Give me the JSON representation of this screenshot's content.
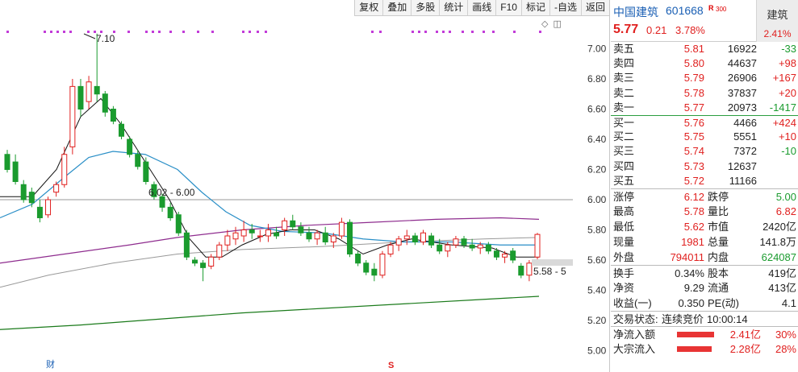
{
  "toolbar": [
    "复权",
    "叠加",
    "多股",
    "统计",
    "画线",
    "F10",
    "标记",
    "-自选",
    "返回"
  ],
  "chart": {
    "price_axis": [
      "7.00",
      "6.80",
      "6.60",
      "6.40",
      "6.20",
      "6.00",
      "5.80",
      "5.60",
      "5.40",
      "5.20",
      "5.00"
    ],
    "high_label": "7.10",
    "box_label": "6.02 - 6.00",
    "current_label": "5.58 - 5",
    "bottom_marker_left": "财",
    "bottom_marker_right": "S",
    "colors": {
      "up": "#e0201f",
      "down": "#1a9b2e",
      "ma5": "#111111",
      "ma10": "#2a8fc7",
      "ma20": "#8e2c8e",
      "ma60": "#999999",
      "ma120": "#1a7a1a",
      "marker": "#c23bd8"
    }
  },
  "chart_data": {
    "type": "candlestick",
    "ylim": [
      4.95,
      7.15
    ],
    "candles": [
      [
        6.3,
        6.33,
        6.18,
        6.2
      ],
      [
        6.25,
        6.3,
        6.1,
        6.12
      ],
      [
        6.1,
        6.13,
        5.98,
        6.0
      ],
      [
        6.05,
        6.08,
        5.95,
        5.98
      ],
      [
        5.95,
        6.0,
        5.85,
        5.88
      ],
      [
        5.9,
        6.02,
        5.88,
        6.0
      ],
      [
        6.05,
        6.12,
        6.02,
        6.1
      ],
      [
        6.1,
        6.35,
        6.08,
        6.3
      ],
      [
        6.35,
        6.8,
        6.3,
        6.75
      ],
      [
        6.75,
        6.8,
        6.55,
        6.6
      ],
      [
        6.65,
        6.82,
        6.6,
        6.78
      ],
      [
        6.75,
        7.1,
        6.65,
        6.7
      ],
      [
        6.7,
        6.72,
        6.55,
        6.58
      ],
      [
        6.6,
        6.62,
        6.5,
        6.52
      ],
      [
        6.5,
        6.52,
        6.4,
        6.42
      ],
      [
        6.4,
        6.42,
        6.28,
        6.3
      ],
      [
        6.3,
        6.33,
        6.2,
        6.22
      ],
      [
        6.25,
        6.28,
        6.1,
        6.12
      ],
      [
        6.1,
        6.12,
        6.0,
        6.02
      ],
      [
        6.02,
        6.04,
        5.92,
        5.95
      ],
      [
        5.95,
        5.98,
        5.86,
        5.88
      ],
      [
        5.9,
        5.92,
        5.76,
        5.78
      ],
      [
        5.78,
        5.8,
        5.6,
        5.62
      ],
      [
        5.6,
        5.62,
        5.56,
        5.58
      ],
      [
        5.58,
        5.6,
        5.46,
        5.55
      ],
      [
        5.56,
        5.64,
        5.54,
        5.62
      ],
      [
        5.62,
        5.72,
        5.6,
        5.7
      ],
      [
        5.7,
        5.8,
        5.66,
        5.76
      ],
      [
        5.74,
        5.82,
        5.7,
        5.78
      ],
      [
        5.76,
        5.86,
        5.72,
        5.8
      ],
      [
        5.8,
        5.84,
        5.74,
        5.78
      ],
      [
        5.76,
        5.8,
        5.72,
        5.76
      ],
      [
        5.76,
        5.84,
        5.72,
        5.8
      ],
      [
        5.78,
        5.82,
        5.74,
        5.76
      ],
      [
        5.8,
        5.88,
        5.76,
        5.86
      ],
      [
        5.86,
        5.9,
        5.8,
        5.82
      ],
      [
        5.82,
        5.85,
        5.76,
        5.78
      ],
      [
        5.78,
        5.82,
        5.72,
        5.74
      ],
      [
        5.74,
        5.8,
        5.7,
        5.78
      ],
      [
        5.78,
        5.82,
        5.7,
        5.72
      ],
      [
        5.72,
        5.78,
        5.68,
        5.76
      ],
      [
        5.76,
        5.88,
        5.74,
        5.85
      ],
      [
        5.85,
        5.87,
        5.62,
        5.64
      ],
      [
        5.64,
        5.66,
        5.56,
        5.58
      ],
      [
        5.58,
        5.6,
        5.5,
        5.52
      ],
      [
        5.54,
        5.58,
        5.46,
        5.5
      ],
      [
        5.5,
        5.66,
        5.48,
        5.64
      ],
      [
        5.64,
        5.72,
        5.62,
        5.7
      ],
      [
        5.7,
        5.76,
        5.66,
        5.74
      ],
      [
        5.74,
        5.8,
        5.7,
        5.76
      ],
      [
        5.76,
        5.78,
        5.7,
        5.72
      ],
      [
        5.72,
        5.8,
        5.7,
        5.78
      ],
      [
        5.76,
        5.78,
        5.68,
        5.7
      ],
      [
        5.7,
        5.74,
        5.64,
        5.66
      ],
      [
        5.66,
        5.72,
        5.62,
        5.7
      ],
      [
        5.7,
        5.76,
        5.68,
        5.74
      ],
      [
        5.74,
        5.76,
        5.68,
        5.7
      ],
      [
        5.7,
        5.74,
        5.66,
        5.68
      ],
      [
        5.68,
        5.72,
        5.64,
        5.7
      ],
      [
        5.7,
        5.72,
        5.64,
        5.66
      ],
      [
        5.66,
        5.68,
        5.6,
        5.62
      ],
      [
        5.62,
        5.66,
        5.58,
        5.64
      ],
      [
        5.66,
        5.68,
        5.58,
        5.6
      ],
      [
        5.56,
        5.58,
        5.48,
        5.5
      ],
      [
        5.5,
        5.6,
        5.46,
        5.58
      ],
      [
        5.62,
        5.78,
        5.6,
        5.77
      ]
    ]
  },
  "stock": {
    "name": "中国建筑",
    "code": "601668",
    "r_badge": "R",
    "r_num": "300",
    "price": "5.77",
    "change": "0.21",
    "change_pct": "3.78%",
    "sector": "建筑",
    "sector_pct": "2.41%"
  },
  "sell": [
    {
      "label": "卖五",
      "price": "5.81",
      "vol": "16922",
      "delta": "-33",
      "delta_color": "green"
    },
    {
      "label": "卖四",
      "price": "5.80",
      "vol": "44637",
      "delta": "+98",
      "delta_color": "red"
    },
    {
      "label": "卖三",
      "price": "5.79",
      "vol": "26906",
      "delta": "+167",
      "delta_color": "red"
    },
    {
      "label": "卖二",
      "price": "5.78",
      "vol": "37837",
      "delta": "+20",
      "delta_color": "red"
    },
    {
      "label": "卖一",
      "price": "5.77",
      "vol": "20973",
      "delta": "-1417",
      "delta_color": "green"
    }
  ],
  "buy": [
    {
      "label": "买一",
      "price": "5.76",
      "vol": "4466",
      "delta": "+424",
      "delta_color": "red"
    },
    {
      "label": "买二",
      "price": "5.75",
      "vol": "5551",
      "delta": "+10",
      "delta_color": "red"
    },
    {
      "label": "买三",
      "price": "5.74",
      "vol": "7372",
      "delta": "-10",
      "delta_color": "green"
    },
    {
      "label": "买四",
      "price": "5.73",
      "vol": "12637",
      "delta": "",
      "delta_color": "red"
    },
    {
      "label": "买五",
      "price": "5.72",
      "vol": "11166",
      "delta": "",
      "delta_color": "red"
    }
  ],
  "stats1": [
    {
      "l1": "涨停",
      "v1": "6.12",
      "c1": "red",
      "l2": "跌停",
      "v2": "5.00",
      "c2": "green"
    },
    {
      "l1": "最高",
      "v1": "5.78",
      "c1": "red",
      "l2": "量比",
      "v2": "6.82",
      "c2": "red"
    },
    {
      "l1": "最低",
      "v1": "5.62",
      "c1": "red",
      "l2": "市值",
      "v2": "2420亿",
      "c2": "dark"
    },
    {
      "l1": "现量",
      "v1": "1981",
      "c1": "red",
      "l2": "总量",
      "v2": "141.8万",
      "c2": "dark"
    },
    {
      "l1": "外盘",
      "v1": "794011",
      "c1": "red",
      "l2": "内盘",
      "v2": "624087",
      "c2": "green"
    }
  ],
  "stats2": [
    {
      "l1": "换手",
      "v1": "0.34%",
      "c1": "dark",
      "l2": "股本",
      "v2": "419亿",
      "c2": "dark"
    },
    {
      "l1": "净资",
      "v1": "9.29",
      "c1": "dark",
      "l2": "流通",
      "v2": "413亿",
      "c2": "dark"
    },
    {
      "l1": "收益(一)",
      "v1": "0.350",
      "c1": "dark",
      "l2": "PE(动)",
      "v2": "4.1",
      "c2": "dark"
    }
  ],
  "trade_status": {
    "label": "交易状态:",
    "value": "连续竞价",
    "time": "10:00:14"
  },
  "flows": [
    {
      "label": "净流入额",
      "value": "2.41亿",
      "pct": "30%",
      "fill": 0.3
    },
    {
      "label": "大宗流入",
      "value": "2.28亿",
      "pct": "28%",
      "fill": 0.28
    }
  ]
}
